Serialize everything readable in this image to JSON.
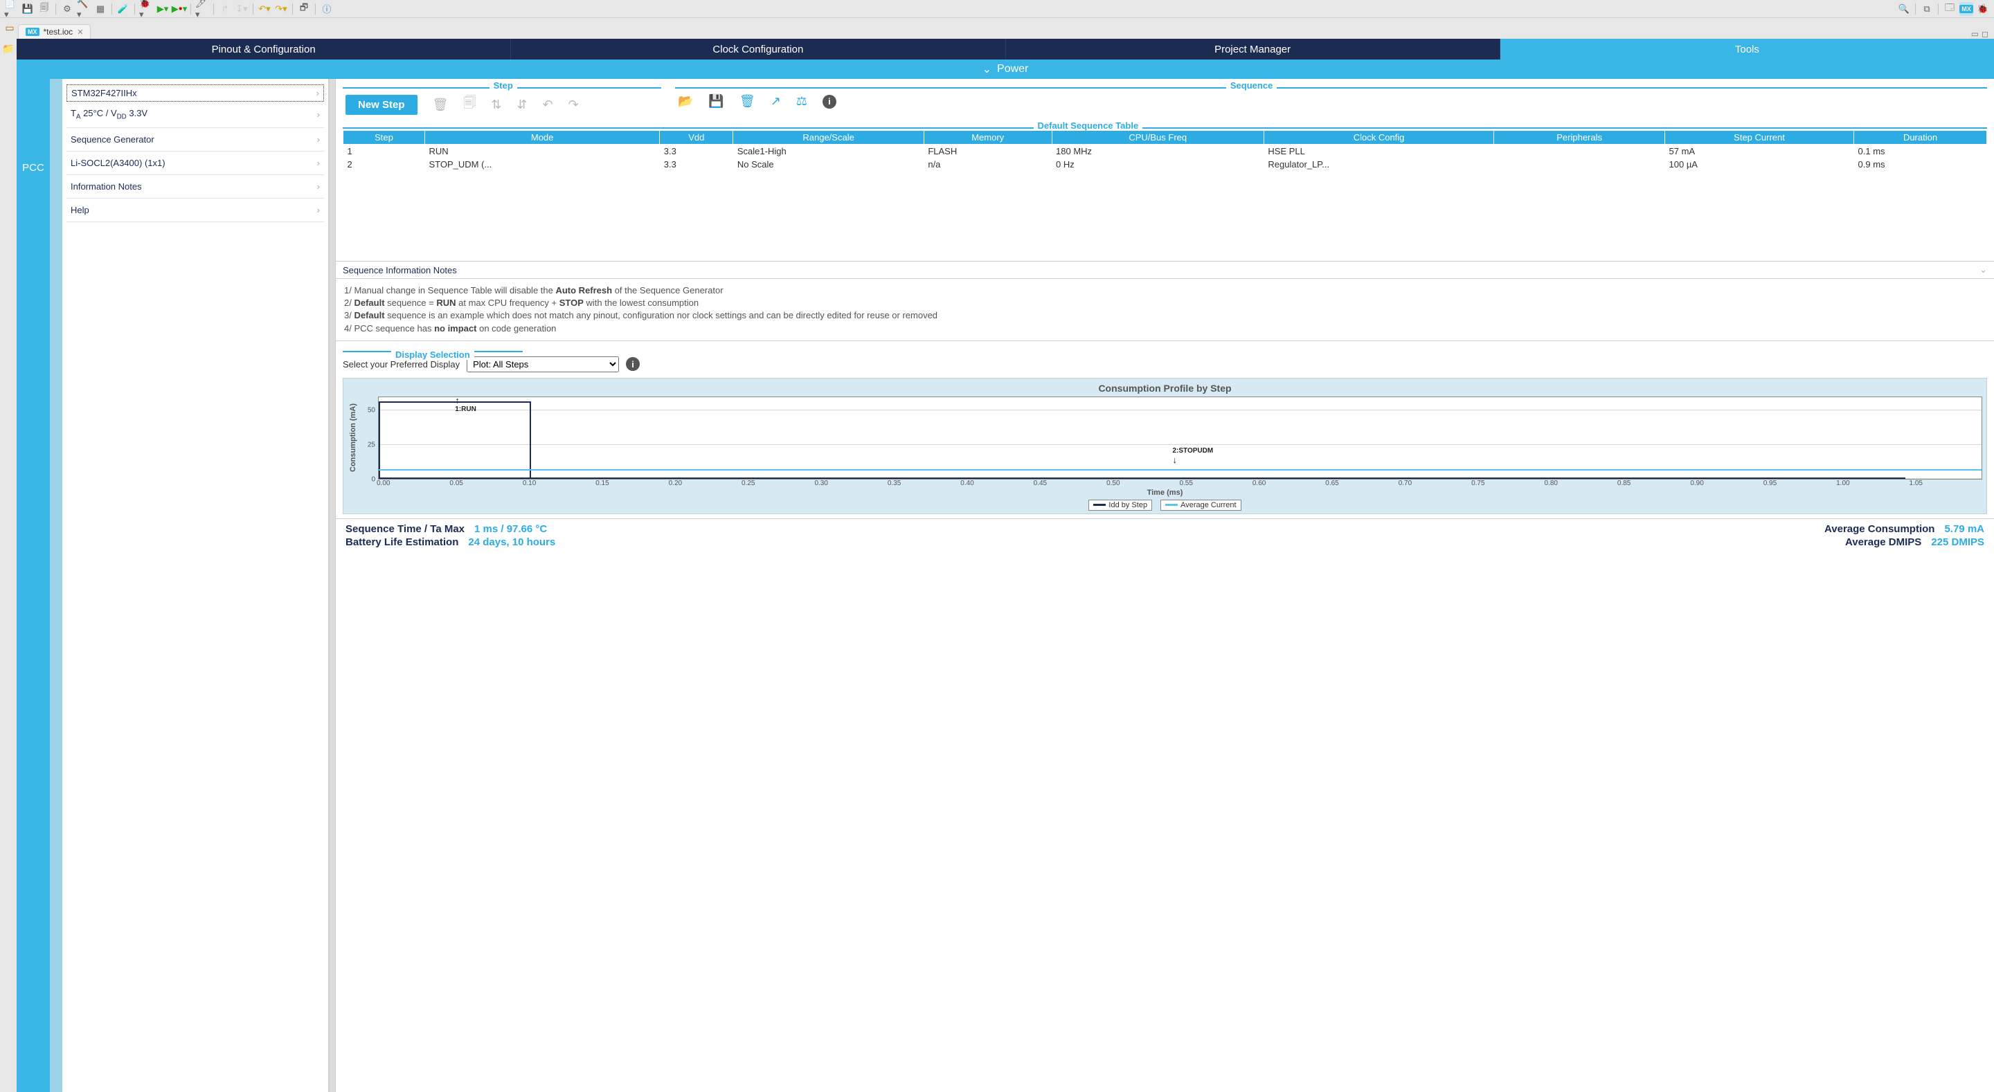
{
  "editor_tab": {
    "file": "*test.ioc"
  },
  "nav": {
    "tabs": [
      "Pinout & Configuration",
      "Clock Configuration",
      "Project Manager",
      "Tools"
    ],
    "active_index": 3
  },
  "power_banner": "Power",
  "pcc_label": "PCC",
  "left_panel": {
    "items": [
      "STM32F427IIHx",
      "T_A 25°C / V_DD 3.3V",
      "Sequence Generator",
      "Li-SOCL2(A3400) (1x1)",
      "Information Notes",
      "Help"
    ]
  },
  "step_section": {
    "label": "Step",
    "new_step_btn": "New Step"
  },
  "sequence_section": {
    "label": "Sequence"
  },
  "seq_table": {
    "label": "Default Sequence Table",
    "headers": [
      "Step",
      "Mode",
      "Vdd",
      "Range/Scale",
      "Memory",
      "CPU/Bus Freq",
      "Clock Config",
      "Peripherals",
      "Step Current",
      "Duration"
    ],
    "rows": [
      {
        "step": "1",
        "mode": "RUN",
        "vdd": "3.3",
        "range": "Scale1-High",
        "mem": "FLASH",
        "freq": "180 MHz",
        "clock": "HSE PLL",
        "periph": "",
        "current": "57 mA",
        "dur": "0.1 ms"
      },
      {
        "step": "2",
        "mode": "STOP_UDM (...",
        "vdd": "3.3",
        "range": "No Scale",
        "mem": "n/a",
        "freq": "0 Hz",
        "clock": "Regulator_LP...",
        "periph": "",
        "current": "100 µA",
        "dur": "0.9 ms"
      }
    ]
  },
  "info_notes": {
    "header": "Sequence Information Notes",
    "lines": [
      [
        "1/ Manual change in Sequence Table will disable the ",
        [
          "b",
          "Auto Refresh"
        ],
        " of the Sequence Generator"
      ],
      [
        "2/ ",
        [
          "b",
          "Default"
        ],
        " sequence = ",
        [
          "b",
          "RUN"
        ],
        " at max CPU frequency + ",
        [
          "b",
          "STOP"
        ],
        " with the lowest consumption"
      ],
      [
        "3/ ",
        [
          "b",
          "Default"
        ],
        " sequence is an example which does not match any pinout, configuration nor clock settings and can be directly edited for reuse or removed"
      ],
      [
        "4/ PCC sequence has ",
        [
          "b",
          "no impact"
        ],
        " on code generation"
      ]
    ]
  },
  "display_sel": {
    "label": "Display Selection",
    "prompt": "Select your Preferred Display",
    "selected": "Plot: All Steps"
  },
  "chart_data": {
    "type": "line",
    "title": "Consumption Profile by Step",
    "xlabel": "Time (ms)",
    "ylabel": "Consumption (mA)",
    "xlim": [
      0,
      1.05
    ],
    "ylim": [
      0,
      60
    ],
    "xticks": [
      0.0,
      0.05,
      0.1,
      0.15,
      0.2,
      0.25,
      0.3,
      0.35,
      0.4,
      0.45,
      0.5,
      0.55,
      0.6,
      0.65,
      0.7,
      0.75,
      0.8,
      0.85,
      0.9,
      0.95,
      1.0,
      1.05
    ],
    "yticks": [
      0,
      25,
      50
    ],
    "series": [
      {
        "name": "Idd by Step",
        "x": [
          0,
          0.1,
          0.1,
          1.0
        ],
        "y": [
          57,
          57,
          0.1,
          0.1
        ]
      },
      {
        "name": "Average Current",
        "x": [
          0,
          1.0
        ],
        "y": [
          5.79,
          5.79
        ]
      }
    ],
    "annotations": [
      {
        "label": "1:RUN",
        "x": 0.05,
        "y": 48,
        "arrow": "up"
      },
      {
        "label": "2:STOPUDM",
        "x": 0.52,
        "y": 10,
        "arrow": "down"
      }
    ],
    "legend": [
      "Idd by Step",
      "Average Current"
    ]
  },
  "footer": {
    "seq_time_label": "Sequence Time / Ta Max",
    "seq_time_val": "1 ms / 97.66 °C",
    "batt_label": "Battery Life Estimation",
    "batt_val": "24 days, 10 hours",
    "avg_cons_label": "Average Consumption",
    "avg_cons_val": "5.79 mA",
    "avg_dmips_label": "Average DMIPS",
    "avg_dmips_val": "225 DMIPS"
  }
}
